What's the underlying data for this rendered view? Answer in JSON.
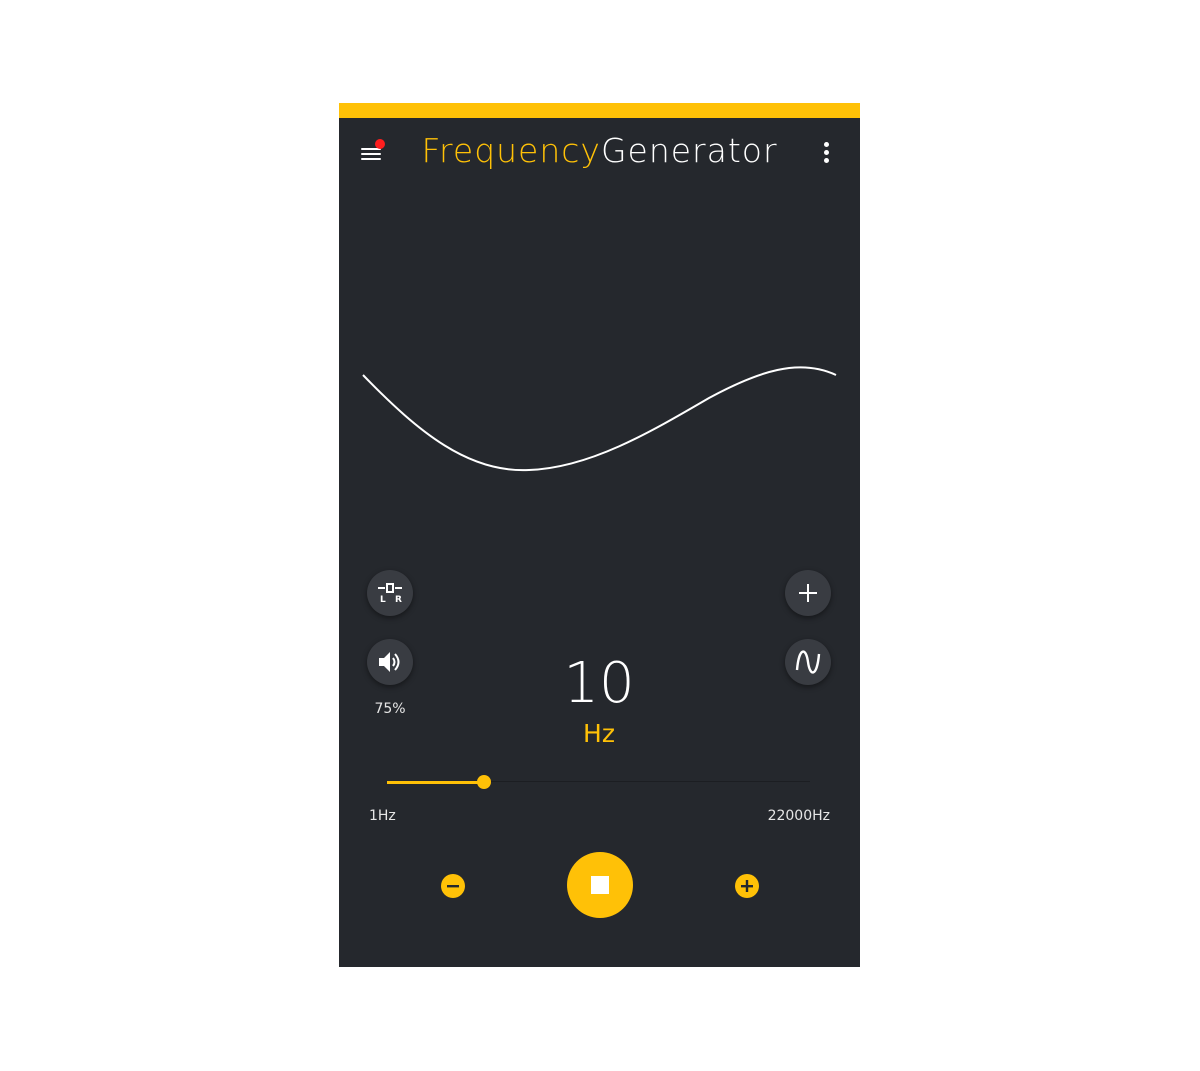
{
  "header": {
    "title_part1": "Frequency",
    "title_part2": "Generator",
    "menu_icon": "hamburger-menu-icon",
    "menu_badge_color": "#ff1e1e",
    "overflow_icon": "more-vertical-icon"
  },
  "colors": {
    "accent": "#ffc107",
    "background": "#25282d",
    "button_background": "#393c42",
    "wave_color": "#ffffff"
  },
  "waveform": {
    "type": "sine"
  },
  "controls": {
    "stereo_icon": "left-right-channel-icon",
    "stereo_label_left": "L",
    "stereo_label_right": "R",
    "volume_icon": "speaker-volume-icon",
    "volume_percent": "75%",
    "add_icon": "plus-icon",
    "waveform_icon": "sine-wave-icon"
  },
  "frequency": {
    "value": "10",
    "unit": "Hz"
  },
  "slider": {
    "min_label": "1Hz",
    "max_label": "22000Hz",
    "position_fraction": 0.23
  },
  "transport": {
    "decrease_icon": "minus-circle-icon",
    "stop_icon": "stop-icon",
    "increase_icon": "plus-circle-icon"
  }
}
